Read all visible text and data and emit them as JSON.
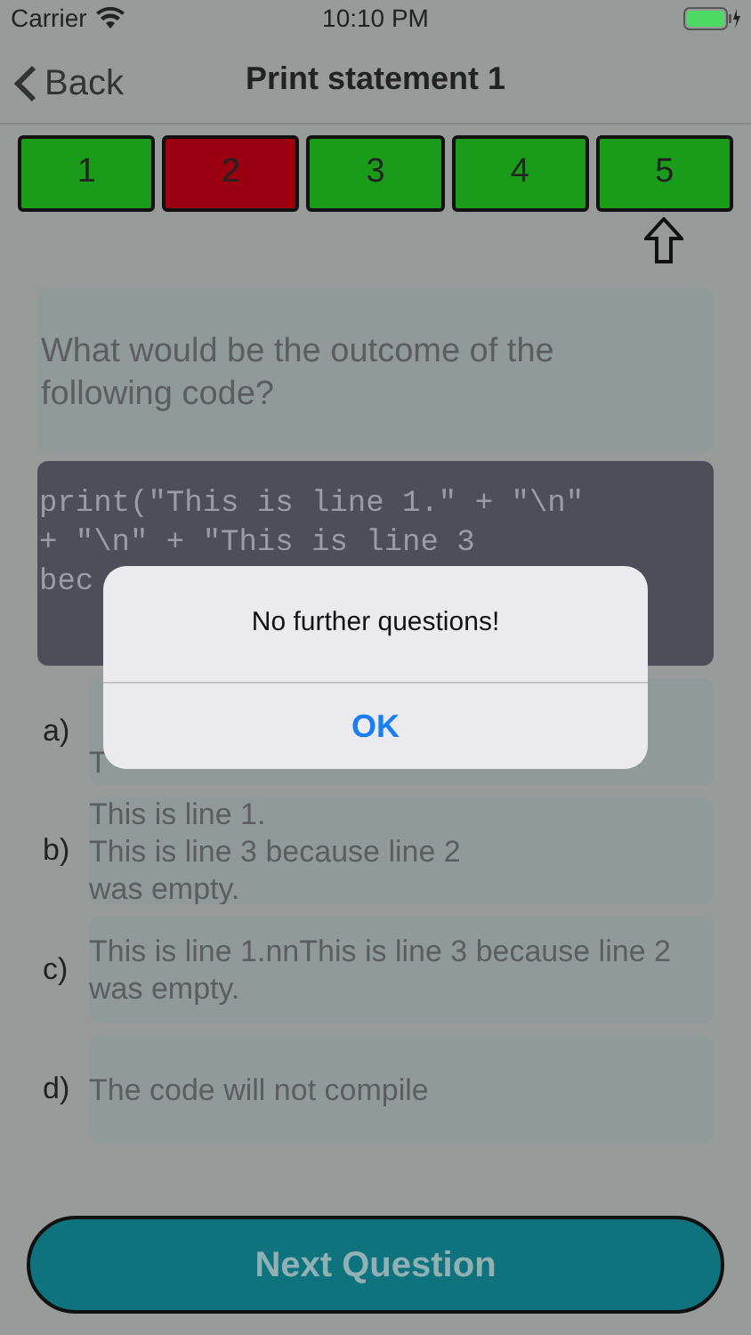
{
  "status_bar": {
    "carrier": "Carrier",
    "time": "10:10 PM"
  },
  "nav": {
    "back": "Back",
    "title": "Print statement 1"
  },
  "question_tabs": [
    {
      "label": "1",
      "color": "#1a9c1a",
      "selected": false
    },
    {
      "label": "2",
      "color": "#9a0010",
      "selected": false
    },
    {
      "label": "3",
      "color": "#1a9c1a",
      "selected": false
    },
    {
      "label": "4",
      "color": "#1a9c1a",
      "selected": false
    },
    {
      "label": "5",
      "color": "#1a9c1a",
      "selected": true
    }
  ],
  "question": "What would be the outcome of the following code?",
  "code_lines": [
    "print(\"This is line 1.\" + \"\\n\"",
    "+ \"\\n\" + \"This is line 3",
    "bec"
  ],
  "answers": [
    {
      "letter": "a)",
      "text": "T"
    },
    {
      "letter": "b)",
      "text": "This is line 1.\nThis is line 3 because line 2\nwas empty."
    },
    {
      "letter": "c)",
      "text": "This is line 1.nnThis is line 3 because line 2 was empty."
    },
    {
      "letter": "d)",
      "text": "The code will not compile"
    }
  ],
  "next_button": "Next Question",
  "alert": {
    "message": "No further questions!",
    "button": "OK"
  }
}
